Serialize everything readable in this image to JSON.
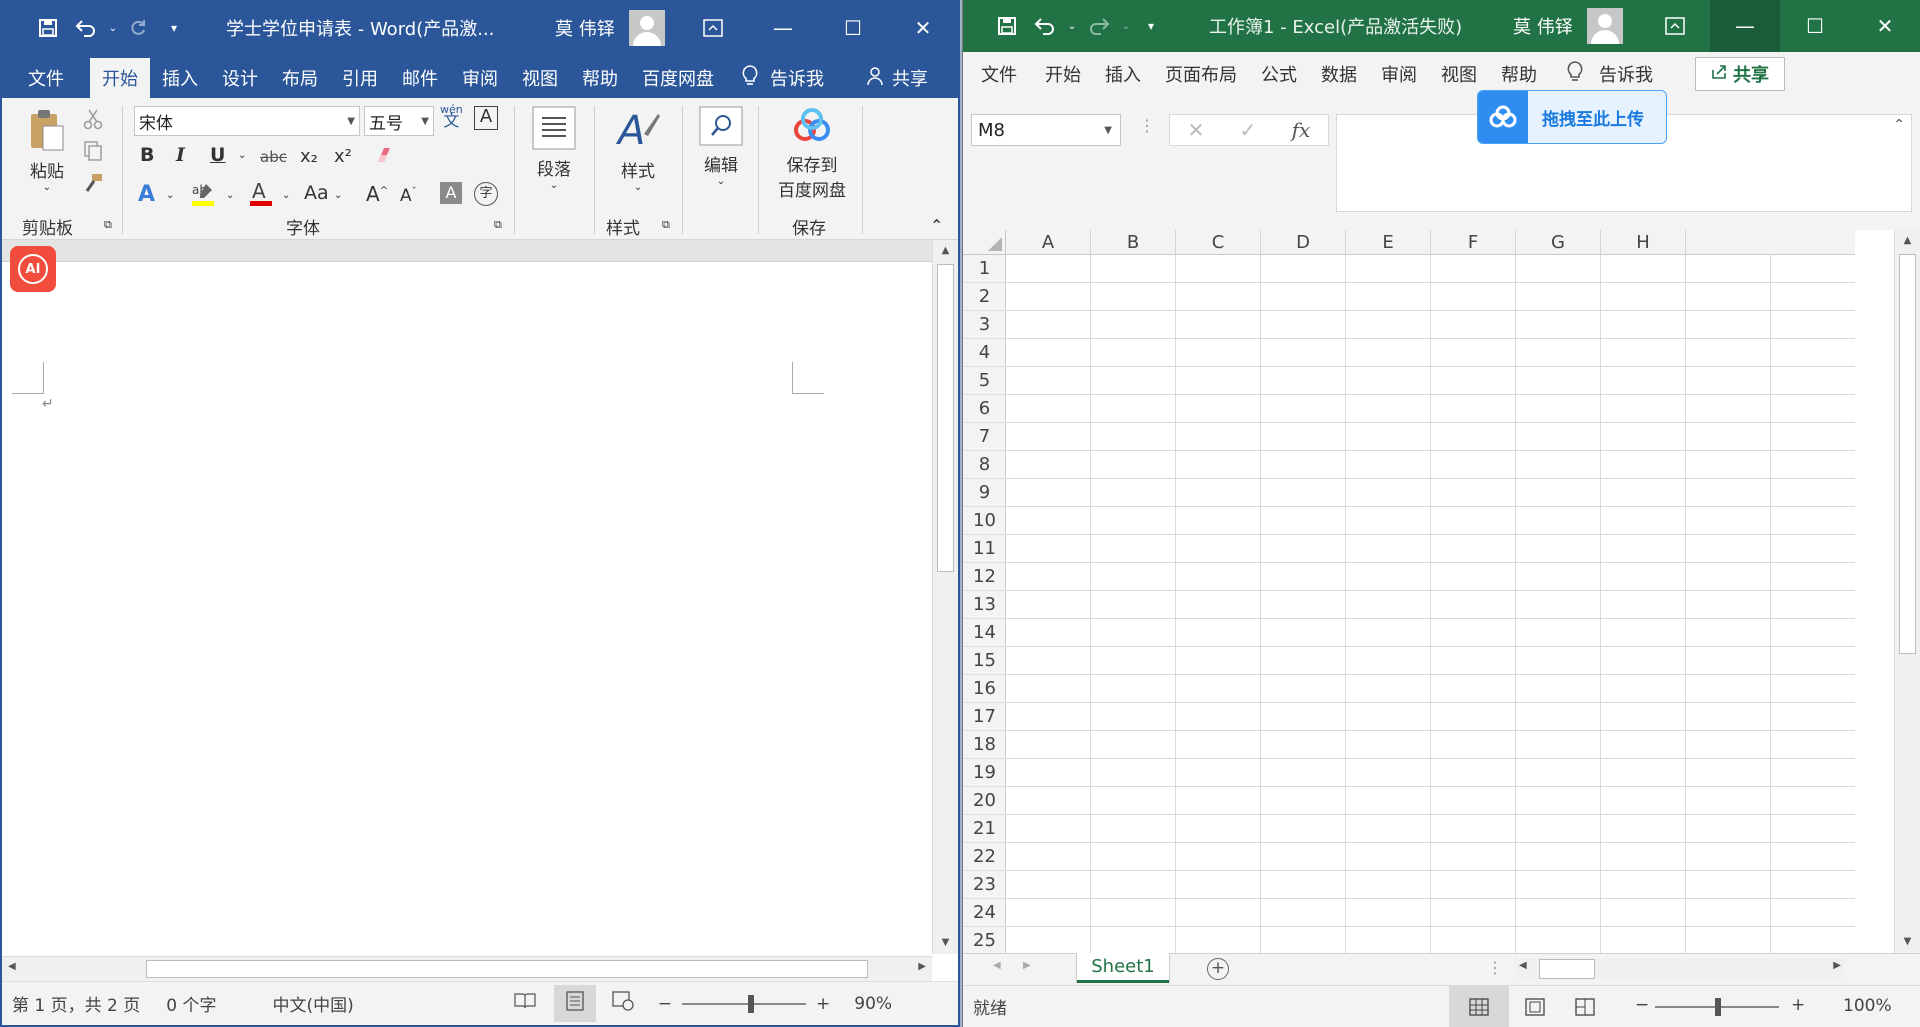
{
  "word": {
    "title": "学士学位申请表 - Word(产品激...",
    "user": "莫 伟铎",
    "tabs": [
      "文件",
      "开始",
      "插入",
      "设计",
      "布局",
      "引用",
      "邮件",
      "审阅",
      "视图",
      "帮助",
      "百度网盘"
    ],
    "tell_me": "告诉我",
    "share": "共享",
    "ribbon": {
      "paste": "粘贴",
      "clipboard_label": "剪贴板",
      "font_name": "宋体",
      "font_size": "五号",
      "font_label": "字体",
      "paragraph": "段落",
      "styles": "样式",
      "styles_label": "样式",
      "editing": "编辑",
      "save_to_baidu_line1": "保存到",
      "save_to_baidu_line2": "百度网盘",
      "save_label": "保存",
      "bold": "B",
      "italic": "I",
      "underline": "U",
      "strike": "abc",
      "subscript": "x₂",
      "superscript": "x²",
      "case": "Aa",
      "grow": "A",
      "shrink": "A",
      "wen": "wén"
    },
    "ai_badge": "AI",
    "status": {
      "page": "第 1 页，共 2 页",
      "words": "0 个字",
      "lang": "中文(中国)",
      "zoom": "90%"
    }
  },
  "excel": {
    "title": "工作簿1 - Excel(产品激活失败)",
    "user": "莫 伟铎",
    "tabs": [
      "文件",
      "开始",
      "插入",
      "页面布局",
      "公式",
      "数据",
      "审阅",
      "视图",
      "帮助"
    ],
    "tell_me": "告诉我",
    "share": "共享",
    "name_box": "M8",
    "fx": "fx",
    "baidu_upload": "拖拽至此上传",
    "columns": [
      "A",
      "B",
      "C",
      "D",
      "E",
      "F",
      "G",
      "H"
    ],
    "rows": [
      "1",
      "2",
      "3",
      "4",
      "5",
      "6",
      "7",
      "8",
      "9",
      "10",
      "11",
      "12",
      "13",
      "14",
      "15",
      "16",
      "17",
      "18",
      "19",
      "20",
      "21",
      "22",
      "23",
      "24",
      "25"
    ],
    "sheet_tab": "Sheet1",
    "status": "就绪",
    "zoom": "100%"
  },
  "colors": {
    "word_blue": "#2b579a",
    "excel_green": "#217346"
  }
}
